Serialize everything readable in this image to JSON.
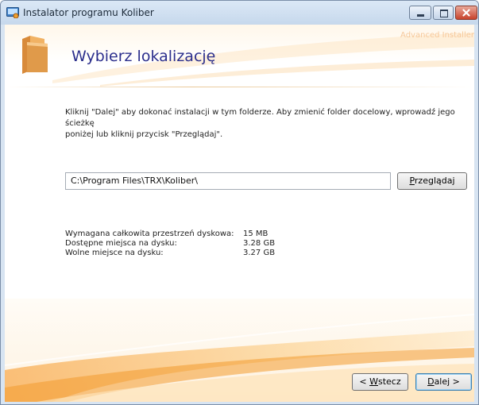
{
  "window": {
    "title": "Instalator programu Koliber",
    "brand": "Advanced Installer"
  },
  "header": {
    "title": "Wybierz lokalizację"
  },
  "instruction": {
    "line1": "Kliknij \"Dalej\" aby dokonać instalacji w tym folderze. Aby zmienić folder docelowy, wprowadź jego ścieżkę",
    "line2": "poniżej lub kliknij przycisk \"Przeglądaj\"."
  },
  "path": {
    "value": "C:\\Program Files\\TRX\\Koliber\\"
  },
  "buttons": {
    "browse_accel": "P",
    "browse_rest": "rzeglądaj",
    "back_pre": "< ",
    "back_accel": "W",
    "back_rest": "stecz",
    "next_accel": "D",
    "next_rest": "alej >"
  },
  "disk_space": [
    {
      "label": "Wymagana całkowita przestrzeń dyskowa:",
      "value": "15 MB"
    },
    {
      "label": "Dostępne miejsca na dysku:",
      "value": "3.28 GB"
    },
    {
      "label": "Wolne miejsce na dysku:",
      "value": "3.27 GB"
    }
  ],
  "icons": {
    "app": "installer-app-icon",
    "header": "folder-icon",
    "minimize": "minimize-icon",
    "maximize": "maximize-icon",
    "close": "close-icon"
  },
  "colors": {
    "title_text": "#2b2e8c",
    "accent_orange": "#f29a2e",
    "close_red": "#c8422a"
  }
}
